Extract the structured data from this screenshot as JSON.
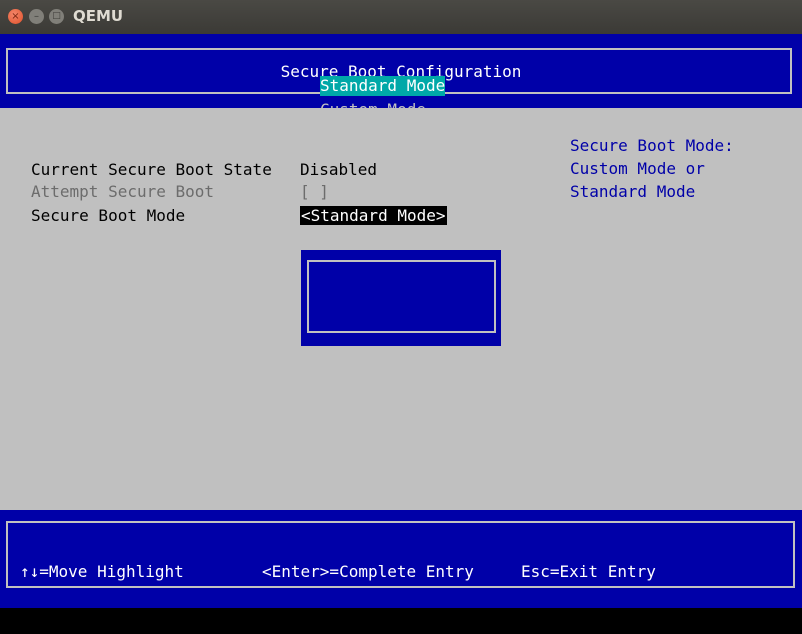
{
  "window": {
    "title": "QEMU"
  },
  "header": {
    "title": "Secure Boot Configuration"
  },
  "settings": [
    {
      "label": "Current Secure Boot State",
      "value": "Disabled"
    },
    {
      "label": "Attempt Secure Boot",
      "value": "[ ]"
    },
    {
      "label": "Secure Boot Mode",
      "value": "<Standard Mode>"
    }
  ],
  "help": {
    "lines": [
      "Secure Boot Mode:",
      "Custom Mode or",
      "Standard Mode"
    ]
  },
  "popup": {
    "options": [
      "Standard Mode",
      "Custom Mode"
    ],
    "selected": "Standard Mode"
  },
  "footer": {
    "move_hint": "↑↓=Move Highlight",
    "enter_hint": "<Enter>=Complete Entry",
    "esc_hint": "Esc=Exit Entry"
  },
  "colors": {
    "bios_blue": "#0000a8",
    "bios_gray": "#c0c0c0",
    "highlight_cyan": "#00a8a8",
    "help_text": "#0000a8"
  }
}
